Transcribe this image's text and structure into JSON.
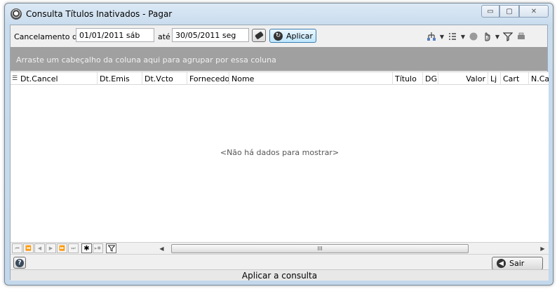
{
  "window": {
    "title": "Consulta Títulos Inativados - Pagar",
    "controls": {
      "minimize": "▭",
      "maximize": "▢",
      "close": "✕"
    }
  },
  "filter": {
    "cancel_label": "Cancelamento de",
    "date_from": "01/01/2011 sáb",
    "until_label": "até",
    "date_to": "30/05/2011 seg",
    "apply_label": "Aplicar"
  },
  "toolbar_icons": [
    "hierarchy-icon",
    "list-options-icon",
    "status-dot-icon",
    "hand-icon",
    "filter-icon",
    "print-icon"
  ],
  "group_panel": {
    "text": "Arraste um cabeçalho da coluna aqui para agrupar por essa coluna"
  },
  "grid": {
    "columns": [
      "Dt.Cancel",
      "Dt.Emis",
      "Dt.Vcto",
      "Fornecedor",
      "Nome",
      "Título",
      "DG",
      "Valor",
      "Lj",
      "Cart",
      "N.Ca"
    ],
    "empty_text": "<Não há dados para mostrar>"
  },
  "navigator": {
    "scroll_grip": "III"
  },
  "bottom": {
    "exit_label": "Sair",
    "help_icon": "?"
  },
  "status": {
    "text": "Aplicar a consulta"
  }
}
